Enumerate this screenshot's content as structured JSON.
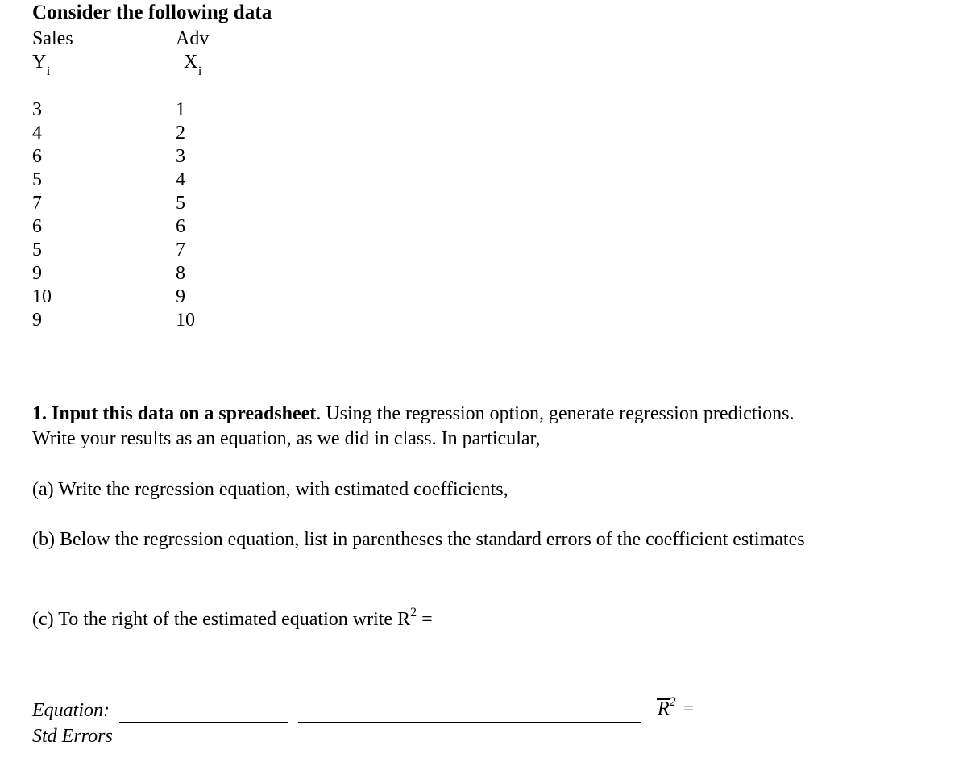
{
  "document": {
    "title": "Consider the following data"
  },
  "table": {
    "header": {
      "col1_name": "Sales",
      "col1_symbol": "Y",
      "col1_subscript": "i",
      "col2_name": "Adv",
      "col2_symbol": "X",
      "col2_subscript": "i"
    },
    "rows": [
      {
        "y": "3",
        "x": "1"
      },
      {
        "y": "4",
        "x": "2"
      },
      {
        "y": "6",
        "x": "3"
      },
      {
        "y": "5",
        "x": "4"
      },
      {
        "y": "7",
        "x": "5"
      },
      {
        "y": "6",
        "x": "6"
      },
      {
        "y": "5",
        "x": "7"
      },
      {
        "y": "9",
        "x": "8"
      },
      {
        "y": "10",
        "x": "9"
      },
      {
        "y": "9",
        "x": "10"
      }
    ]
  },
  "questions": {
    "q1_bold": "1.  Input this data on a spreadsheet",
    "q1_rest": ".  Using the regression option, generate regression predictions.  Write your results as an equation, as we did in class. In particular,",
    "qa": "(a) Write the regression equation, with estimated coefficients,",
    "qb": "(b) Below the regression equation, list in parentheses the standard errors of the coefficient estimates",
    "qc_text": "(c) To the right of the estimated equation write R",
    "qc_superscript": "2",
    "qc_tail": " ="
  },
  "answer": {
    "equation_label": "Equation:",
    "std_errors_label": "Std Errors",
    "rbar_symbol": "R",
    "rbar_superscript": "2",
    "rbar_equals": "="
  },
  "chart_data": {
    "type": "table",
    "title": "Consider the following data",
    "columns": [
      "Sales Y_i",
      "Adv X_i"
    ],
    "x": [
      1,
      2,
      3,
      4,
      5,
      6,
      7,
      8,
      9,
      10
    ],
    "series": [
      {
        "name": "Sales Y_i",
        "values": [
          3,
          4,
          6,
          5,
          7,
          6,
          5,
          9,
          10,
          9
        ]
      },
      {
        "name": "Adv X_i",
        "values": [
          1,
          2,
          3,
          4,
          5,
          6,
          7,
          8,
          9,
          10
        ]
      }
    ],
    "xlabel": "Adv X_i",
    "ylabel": "Sales Y_i"
  }
}
